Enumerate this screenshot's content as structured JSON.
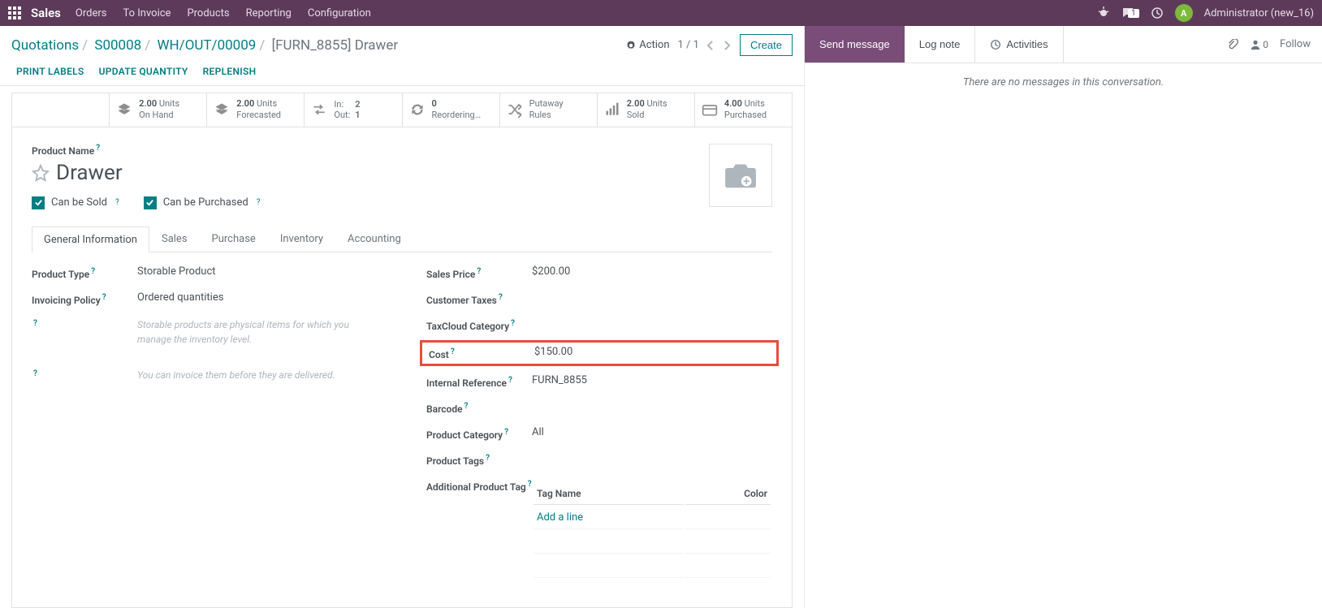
{
  "topbar": {
    "brand": "Sales",
    "menu": [
      "Orders",
      "To Invoice",
      "Products",
      "Reporting",
      "Configuration"
    ],
    "msg_count": "1",
    "avatar_initial": "A",
    "username": "Administrator (new_16)"
  },
  "breadcrumb": {
    "items": [
      "Quotations",
      "S00008",
      "WH/OUT/00009"
    ],
    "current": "[FURN_8855] Drawer"
  },
  "controls": {
    "action": "Action",
    "pager": "1 / 1",
    "create": "Create"
  },
  "action_buttons": [
    "PRINT LABELS",
    "UPDATE QUANTITY",
    "REPLENISH"
  ],
  "stats": {
    "onhand": {
      "v": "2.00",
      "u": "Units",
      "l": "On Hand"
    },
    "forecast": {
      "v": "2.00",
      "u": "Units",
      "l": "Forecasted"
    },
    "inout": {
      "in_l": "In:",
      "in_v": "2",
      "out_l": "Out:",
      "out_v": "1"
    },
    "reorder": {
      "v": "0",
      "l": "Reordering…"
    },
    "putaway": {
      "l1": "Putaway",
      "l2": "Rules"
    },
    "sold": {
      "v": "2.00",
      "u": "Units",
      "l": "Sold"
    },
    "purchased": {
      "v": "4.00",
      "u": "Units",
      "l": "Purchased"
    }
  },
  "product": {
    "name_label": "Product Name",
    "name": "Drawer",
    "can_be_sold": "Can be Sold",
    "can_be_purchased": "Can be Purchased"
  },
  "tabs": [
    "General Information",
    "Sales",
    "Purchase",
    "Inventory",
    "Accounting"
  ],
  "fields_left": {
    "product_type_l": "Product Type",
    "product_type_v": "Storable Product",
    "invoicing_l": "Invoicing Policy",
    "invoicing_v": "Ordered quantities",
    "hint1": "Storable products are physical items for which you manage the inventory level.",
    "hint2": "You can invoice them before they are delivered."
  },
  "fields_right": {
    "sales_price_l": "Sales Price",
    "sales_price_v": "$200.00",
    "cust_taxes_l": "Customer Taxes",
    "taxcloud_l": "TaxCloud Category",
    "cost_l": "Cost",
    "cost_v": "$150.00",
    "intref_l": "Internal Reference",
    "intref_v": "FURN_8855",
    "barcode_l": "Barcode",
    "category_l": "Product Category",
    "category_v": "All",
    "tags_l": "Product Tags",
    "addtag_l": "Additional Product Tag",
    "tag_th1": "Tag Name",
    "tag_th2": "Color",
    "add_line": "Add a line"
  },
  "messaging": {
    "send": "Send message",
    "log": "Log note",
    "activities": "Activities",
    "follower_count": "0",
    "follow": "Follow",
    "empty": "There are no messages in this conversation."
  }
}
